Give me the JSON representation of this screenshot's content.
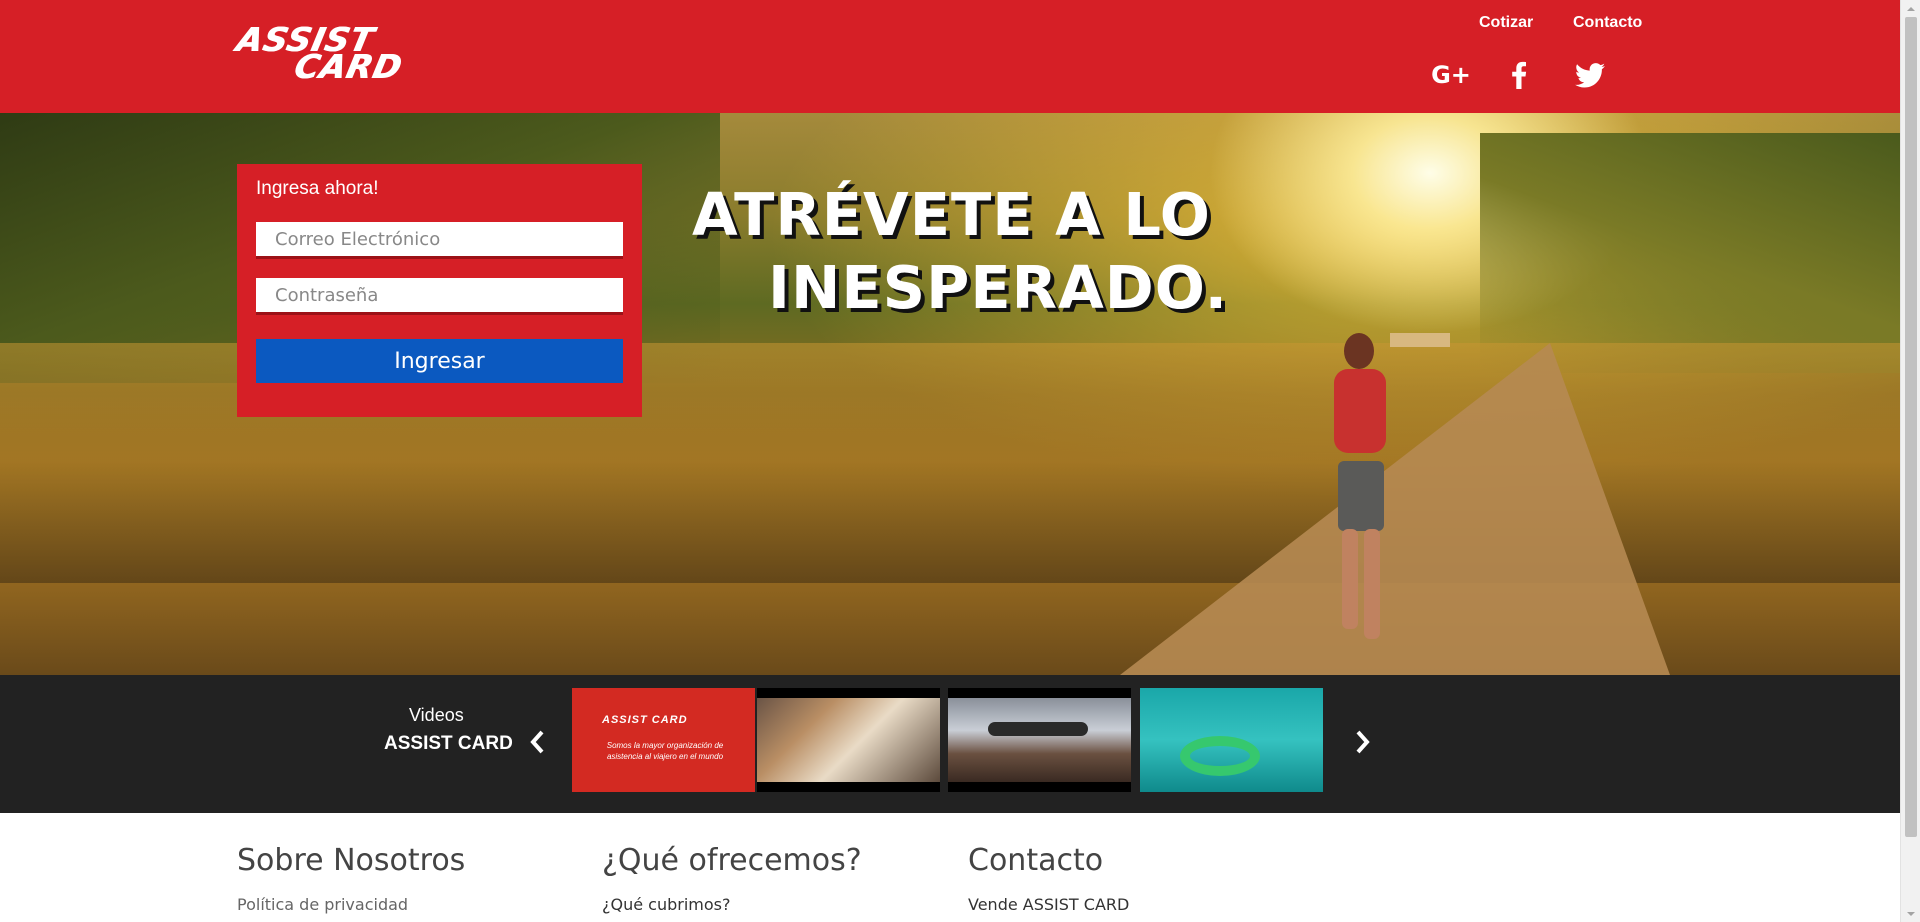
{
  "header": {
    "logo_line1": "ASSIST",
    "logo_line2": "CARD",
    "nav": [
      {
        "label": "Cotizar"
      },
      {
        "label": "Contacto"
      }
    ],
    "social": [
      {
        "icon": "google-plus-icon",
        "label": "G+"
      },
      {
        "icon": "facebook-icon"
      },
      {
        "icon": "twitter-icon"
      }
    ]
  },
  "hero": {
    "headline_line1": "ATRÉVETE A LO",
    "headline_line2": "INESPERADO."
  },
  "login": {
    "title": "Ingresa ahora!",
    "email_placeholder": "Correo Electrónico",
    "password_placeholder": "Contraseña",
    "submit_label": "Ingresar"
  },
  "videos": {
    "label_small": "Videos",
    "label_big": "ASSIST CARD",
    "thumbnails": [
      {
        "brand": "ASSIST CARD",
        "tagline": "Somos la mayor organización de asistencia al viajero en el mundo"
      },
      {},
      {},
      {}
    ]
  },
  "footer": {
    "columns": [
      {
        "title": "Sobre Nosotros",
        "link": "Política de privacidad"
      },
      {
        "title": "¿Qué ofrecemos?",
        "link": "¿Qué cubrimos?"
      },
      {
        "title": "Contacto",
        "link": "Vende ASSIST CARD"
      }
    ]
  },
  "colors": {
    "brand_red": "#d61f26",
    "button_blue": "#0b59c0",
    "video_strip": "#222222",
    "footer_link_gray": "#666666",
    "footer_link_dark": "#333333"
  }
}
